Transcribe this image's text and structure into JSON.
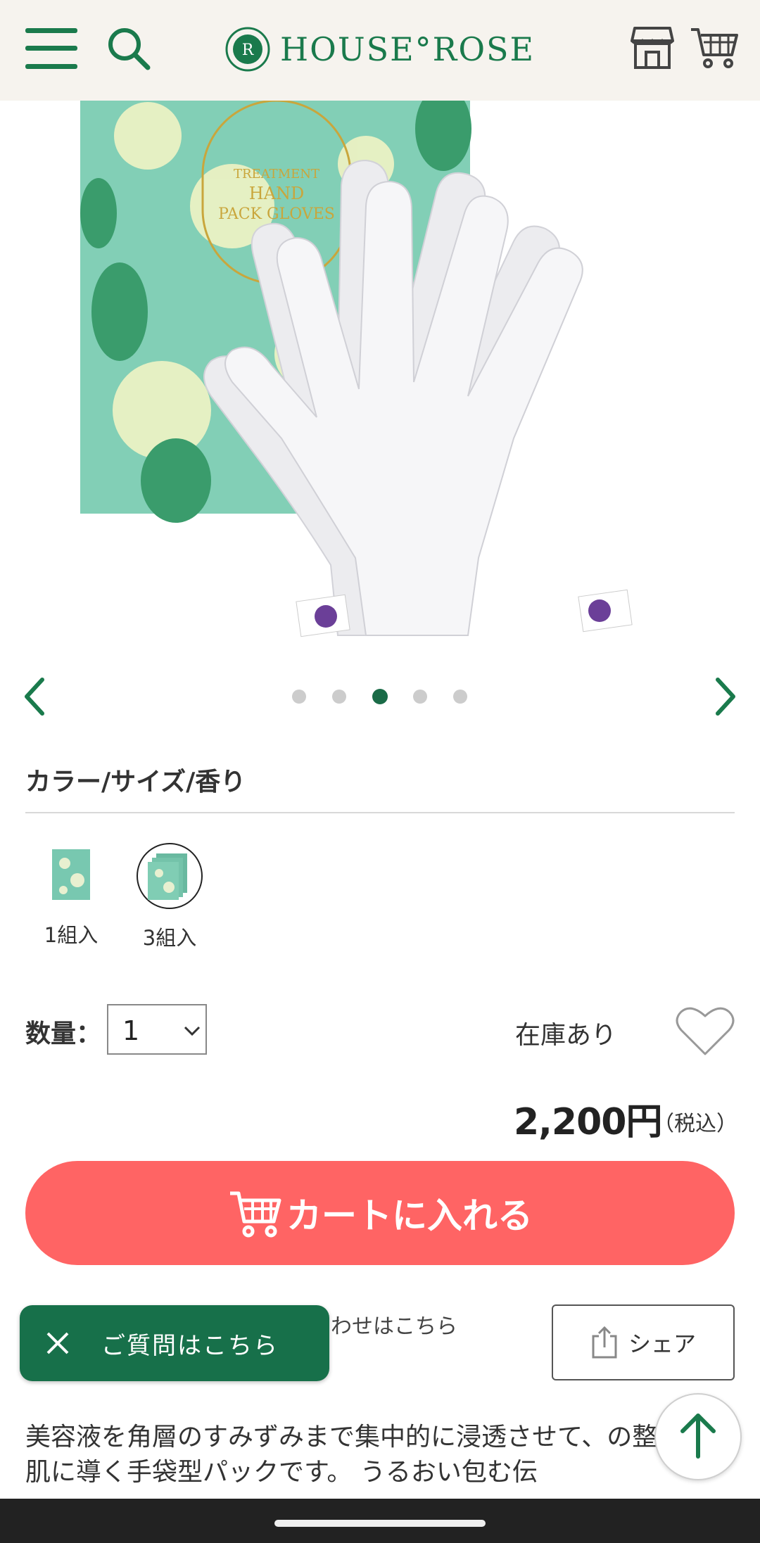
{
  "header": {
    "logo_text": "HOUSE°ROSE",
    "menu_icon": "hamburger-icon",
    "search_icon": "search-icon",
    "shop_icon": "store-icon",
    "cart_icon": "cart-icon",
    "brand_color": "#1a7a4c"
  },
  "gallery": {
    "slide_count": 5,
    "active_slide": 3,
    "prev_icon": "chevron-left-icon",
    "next_icon": "chevron-right-icon"
  },
  "variants": {
    "title": "カラー/サイズ/香り",
    "items": [
      {
        "label": "1組入",
        "selected": false
      },
      {
        "label": "3組入",
        "selected": true
      }
    ]
  },
  "purchase": {
    "quantity_label": "数量：",
    "quantity_value": "1",
    "stock_status": "在庫あり",
    "price": "2,200円",
    "tax_note": "（税込）",
    "add_to_cart_label": "カートに入れる",
    "cart_button_color": "#ff6464"
  },
  "actions": {
    "inquiry_text": "わせはこちら",
    "share_label": "シェア",
    "question_label": "ご質問はこちら"
  },
  "description": "美容液を角層のすみずみまで集中的に浸透させて、の整った手肌に導く手袋型パックです。 うるおい包む伝"
}
